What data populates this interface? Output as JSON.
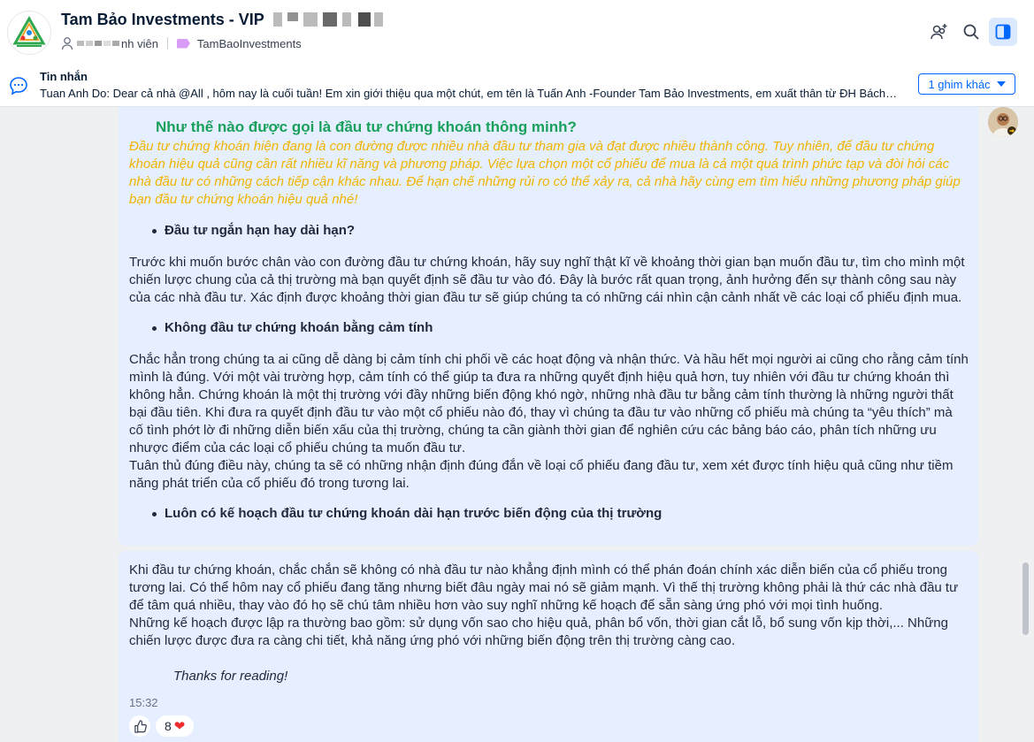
{
  "header": {
    "group_name": "Tam Bảo Investments - VIP",
    "members_label": "nh viên",
    "community_tag": "TamBaoInvestments"
  },
  "pinned": {
    "title": "Tin nhắn",
    "message": "Tuan Anh Do: Dear cả nhà @All , hôm nay là cuối tuần! Em xin giới thiệu qua một chút, em tên là Tuấn Anh -Founder Tam Bảo Investments, em xuất thân từ ĐH Bách Khoa Hà Nội",
    "more_label": "1 ghim khác"
  },
  "message": {
    "heading": "Như thế nào được gọi là đầu tư chứng khoán thông minh?",
    "intro": "Đầu tư chứng khoán hiện đang là con đường được nhiều nhà đầu tư tham gia và đạt được nhiều thành công. Tuy nhiên, để đầu tư chứng khoán hiệu quả cũng cần rất nhiều kĩ năng và phương pháp. Việc lựa chọn một cổ phiếu để mua là cả một quá trình phức tạp và đòi hỏi các nhà đầu tư có những cách tiếp cận khác nhau. Để hạn chế những rủi ro có thể xảy ra, cả nhà hãy cùng em tìm hiểu những phương pháp giúp bạn đầu tư chứng khoán hiệu quả nhé!",
    "bullet1": "Đầu tư ngắn hạn hay dài hạn?",
    "para1": "Trước khi muốn bước chân vào con đường đầu tư chứng khoán, hãy suy nghĩ thật kĩ về khoảng thời gian bạn muốn đầu tư, tìm cho mình một chiến lược chung của cả thị trường mà bạn quyết định sẽ đầu tư vào đó. Đây là bước rất quan trọng, ảnh hưởng đến sự thành công sau này của các nhà đầu tư. Xác định được khoảng thời gian đầu tư sẽ giúp chúng ta có những cái nhìn cận cảnh nhất về các loại cổ phiếu định mua.",
    "bullet2": "Không đầu tư chứng khoán bằng cảm tính",
    "para2": "Chắc hẳn trong chúng ta ai cũng dễ dàng bị cảm tính chi phối về các hoạt động và nhận thức. Và hầu hết mọi người ai cũng cho rằng cảm tính mình là đúng. Với một vài trường hợp, cảm tính có thể giúp ta đưa ra những quyết định hiệu quả hơn, tuy nhiên với đầu tư chứng khoán thì không hẳn. Chứng khoán là một thị trường với đầy những biến động khó ngờ, những nhà đầu tư bằng cảm tính thường là những người thất bại đầu tiên. Khi đưa ra quyết định đầu tư vào một cổ phiếu nào đó, thay vì chúng ta đầu tư vào những cổ phiếu mà chúng ta “yêu thích” mà cố tình phớt lờ đi những diễn biến xấu của thị trường, chúng ta cần giành thời gian để nghiên cứu các bảng báo cáo, phân tích những ưu nhược điểm của các loại cổ phiếu chúng ta muốn đầu tư.",
    "para3": "Tuân thủ đúng điều này, chúng ta sẽ có những nhận định đúng đắn về loại cổ phiếu đang đầu tư, xem xét được tính hiệu quả cũng như tiềm năng phát triển của cổ phiếu đó trong tương lai.",
    "bullet3": "Luôn có kế hoạch đầu tư chứng khoán dài hạn trước biến động của thị trường",
    "para4": "Khi đầu tư chứng khoán, chắc chắn sẽ không có nhà đầu tư nào khẳng định mình có thể phán đoán chính xác diễn biến của cổ phiếu trong tương lai. Có thể hôm nay cổ phiếu đang tăng nhưng biết đâu ngày mai nó sẽ giảm mạnh. Vì thế thị trường không phải là thứ các nhà đầu tư để tâm quá nhiều, thay vào đó họ sẽ chú tâm nhiều hơn vào suy nghĩ những kế hoạch để sẵn sàng ứng phó với mọi tình huống.",
    "para5": "Những kế hoạch được lập ra thường bao gồm: sử dụng vốn sao cho hiệu quả, phân bổ vốn, thời gian cắt lỗ, bổ sung vốn kịp thời,... Những chiến lược được đưa ra càng chi tiết, khả năng ứng phó với những biến động trên thị trường càng cao.",
    "thanks": "Thanks for reading!",
    "time": "15:32",
    "reaction_count": "8",
    "reaction_emoji": "❤"
  },
  "colors": {
    "accent": "#0068ff",
    "heading": "#1aa05b",
    "intro": "#f0b400",
    "bubble": "#e5efff"
  }
}
